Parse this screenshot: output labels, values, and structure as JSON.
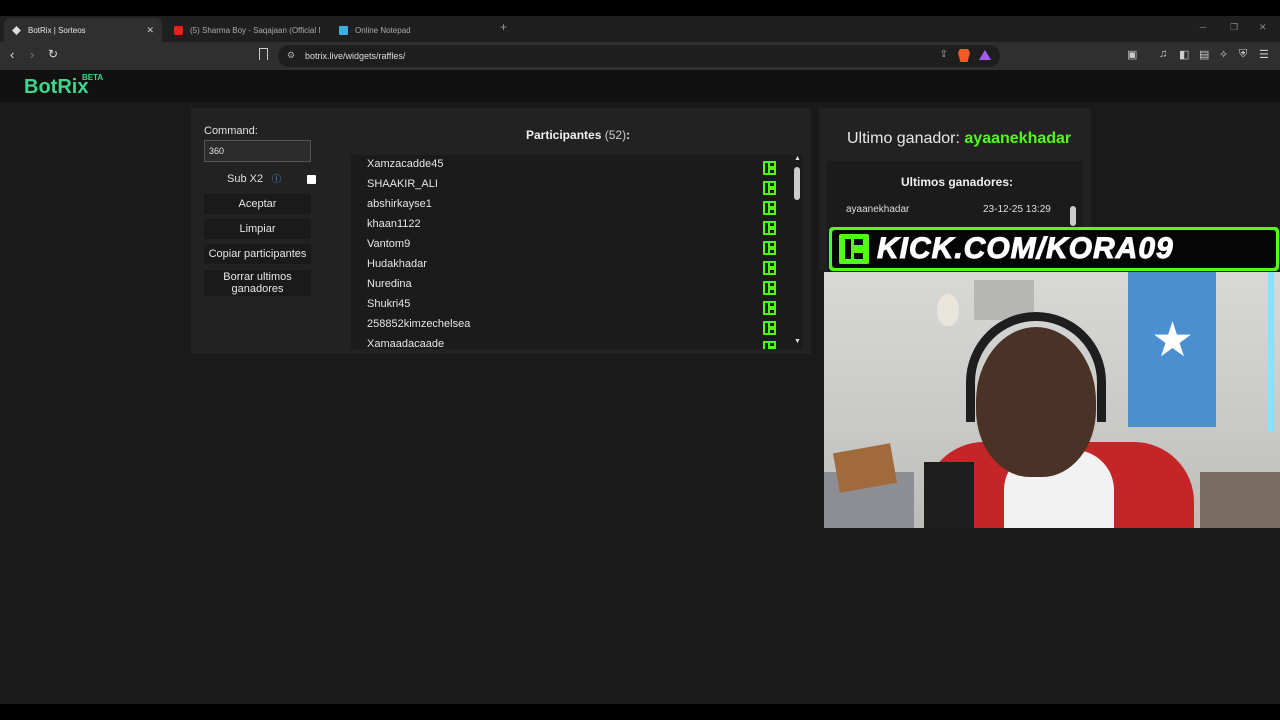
{
  "browser": {
    "tabs": [
      {
        "title": "BotRix | Sorteos",
        "active": true
      },
      {
        "title": "(5) Sharma Boy - Saqajaan (Official M",
        "active": false
      },
      {
        "title": "Online Notepad",
        "active": false
      }
    ],
    "url": "botrix.live/widgets/raffles/"
  },
  "site": {
    "logo": "BotRix",
    "logo_badge": "BETA"
  },
  "raffle": {
    "command_label": "Command:",
    "command_value": "360",
    "sub_label": "Sub X2",
    "sub_checked": false,
    "buttons": {
      "accept": "Aceptar",
      "clear": "Limpiar",
      "copy": "Copiar participantes",
      "delete_winners": "Borrar ultimos ganadores"
    },
    "participants_title": "Participantes",
    "participants_count": "(52)",
    "participants_colon": ":",
    "participants": [
      "Xamzacadde45",
      "SHAAKIR_ALI",
      "abshirkayse1",
      "khaan1122",
      "Vantom9",
      "Hudakhadar",
      "Nuredina",
      "Shukri45",
      "258852kimzechelsea",
      "Xamaadacaade"
    ]
  },
  "winners": {
    "last_winner_label": "Ultimo ganador:",
    "last_winner_name": "ayaanekhadar",
    "recent_title": "Ultimos ganadores:",
    "list": [
      {
        "name": "ayaanekhadar",
        "date": "23-12-25 13:29"
      }
    ]
  },
  "overlay": {
    "banner_text": "KICK.COM/KORA09"
  },
  "colors": {
    "kick_green": "#53fc18",
    "botrix_green": "#3dd68c"
  }
}
